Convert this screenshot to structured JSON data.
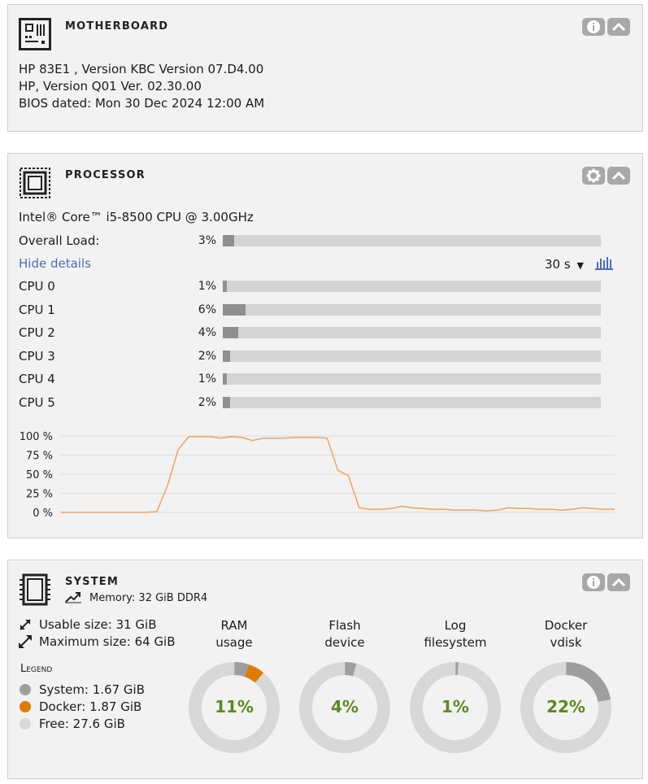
{
  "motherboard": {
    "title": "MOTHERBOARD",
    "lines": [
      "HP 83E1 , Version KBC Version 07.D4.00",
      "HP, Version Q01 Ver. 02.30.00",
      "BIOS dated: Mon 30 Dec 2024 12:00 AM"
    ]
  },
  "processor": {
    "title": "PROCESSOR",
    "model": "Intel® Core™ i5-8500 CPU @ 3.00GHz",
    "overall_label": "Overall Load:",
    "overall_value": "3%",
    "overall_fraction": 0.03,
    "hide_details": "Hide details",
    "interval": "30 s",
    "cores": [
      {
        "label": "CPU 0",
        "value": "1%",
        "fraction": 0.01
      },
      {
        "label": "CPU 1",
        "value": "6%",
        "fraction": 0.06
      },
      {
        "label": "CPU 2",
        "value": "4%",
        "fraction": 0.04
      },
      {
        "label": "CPU 3",
        "value": "2%",
        "fraction": 0.02
      },
      {
        "label": "CPU 4",
        "value": "1%",
        "fraction": 0.01
      },
      {
        "label": "CPU 5",
        "value": "2%",
        "fraction": 0.02
      }
    ],
    "chart_data": {
      "type": "line",
      "yticks": [
        "100 %",
        "75 %",
        "50 %",
        "25 %",
        "0 %"
      ],
      "ylim": [
        0,
        100
      ],
      "series_color": "#f0a35e",
      "values": [
        0,
        0,
        0,
        0,
        0,
        0,
        0,
        0,
        0,
        1,
        35,
        82,
        99,
        99,
        99,
        97,
        99,
        98,
        94,
        97,
        97,
        97,
        98,
        98,
        98,
        97,
        55,
        48,
        6,
        4,
        4,
        5,
        8,
        6,
        5,
        4,
        4,
        3,
        3,
        3,
        2,
        3,
        6,
        5,
        5,
        4,
        4,
        3,
        4,
        6,
        5,
        4,
        4
      ]
    }
  },
  "system": {
    "title": "SYSTEM",
    "memory": "Memory: 32 GiB DDR4",
    "usable": "Usable size: 31 GiB",
    "maximum": "Maximum size: 64 GiB",
    "legend_title": "Legend",
    "legend": [
      {
        "label": "System: 1.67 GiB",
        "color": "#9e9e9e"
      },
      {
        "label": "Docker: 1.87 GiB",
        "color": "#e07b00"
      },
      {
        "label": "Free: 27.6 GiB",
        "color": "#d8d8d8"
      }
    ],
    "donuts": [
      {
        "title1": "RAM",
        "title2": "usage",
        "pct": "11%",
        "segments": [
          {
            "fraction": 0.052,
            "color": "#9e9e9e"
          },
          {
            "fraction": 0.058,
            "color": "#e07b00"
          }
        ]
      },
      {
        "title1": "Flash",
        "title2": "device",
        "pct": "4%",
        "segments": [
          {
            "fraction": 0.04,
            "color": "#9e9e9e"
          }
        ]
      },
      {
        "title1": "Log",
        "title2": "filesystem",
        "pct": "1%",
        "segments": [
          {
            "fraction": 0.01,
            "color": "#9e9e9e"
          }
        ]
      },
      {
        "title1": "Docker",
        "title2": "vdisk",
        "pct": "22%",
        "segments": [
          {
            "fraction": 0.22,
            "color": "#9e9e9e"
          }
        ]
      }
    ]
  }
}
